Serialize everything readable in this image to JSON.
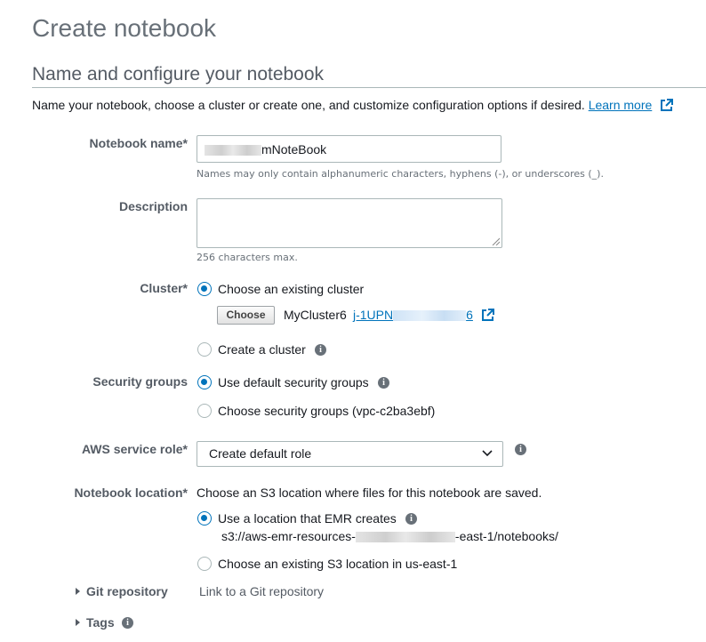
{
  "page": {
    "title": "Create notebook"
  },
  "section": {
    "title": "Name and configure your notebook",
    "intro": "Name your notebook, choose a cluster or create one, and customize configuration options if desired.",
    "learn_more": "Learn more"
  },
  "notebook_name": {
    "label": "Notebook name*",
    "value": "mNoteBook",
    "hint": "Names may only contain alphanumeric characters, hyphens (-), or underscores (_)."
  },
  "description": {
    "label": "Description",
    "value": "",
    "hint": "256 characters max."
  },
  "cluster": {
    "label": "Cluster*",
    "options": [
      {
        "label": "Choose an existing cluster",
        "selected": true
      },
      {
        "label": "Create a cluster",
        "selected": false
      }
    ],
    "choose_button": "Choose",
    "cluster_name": "MyCluster6",
    "cluster_id_prefix": "j-1UPN",
    "cluster_id_suffix": "6"
  },
  "security_groups": {
    "label": "Security groups",
    "options": [
      {
        "label": "Use default security groups",
        "selected": true
      },
      {
        "label": "Choose security groups (vpc-c2ba3ebf)",
        "selected": false
      }
    ]
  },
  "service_role": {
    "label": "AWS service role*",
    "value": "Create default role"
  },
  "notebook_location": {
    "label": "Notebook location*",
    "description": "Choose an S3 location where files for this notebook are saved.",
    "options": [
      {
        "label": "Use a location that EMR creates",
        "selected": true
      },
      {
        "label": "Choose an existing S3 location in us-east-1",
        "selected": false
      }
    ],
    "path_prefix": "s3://aws-emr-resources-",
    "path_suffix": "-east-1/notebooks/"
  },
  "git_repository": {
    "label": "Git repository",
    "link": "Link to a Git repository"
  },
  "tags": {
    "label": "Tags"
  },
  "icons": {
    "external_link": "external-link-icon",
    "info": "info-icon",
    "caret": "caret-right-icon",
    "chevron": "chevron-down-icon"
  },
  "colors": {
    "link": "#0073bb",
    "label": "#545b64",
    "border": "#aab7b8"
  }
}
